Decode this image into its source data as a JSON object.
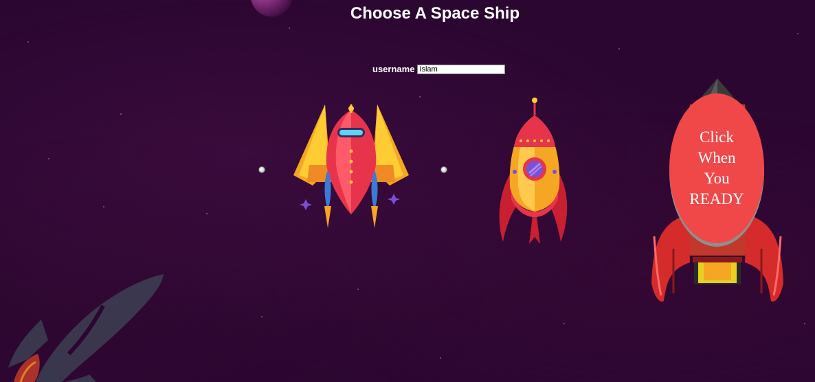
{
  "header": {
    "title": "Choose A Space Ship"
  },
  "form": {
    "username_label": "username",
    "username_value": "Islam"
  },
  "ships": [
    {
      "name": "fighter-ship"
    },
    {
      "name": "rocket-ship"
    }
  ],
  "ready_button": {
    "line1": "Click",
    "line2": "When",
    "line3": "You",
    "line4": "READY"
  },
  "colors": {
    "background": "#2a0630",
    "ready_button": "#f04848",
    "ship_red": "#e8344a",
    "ship_yellow": "#f5a623"
  }
}
